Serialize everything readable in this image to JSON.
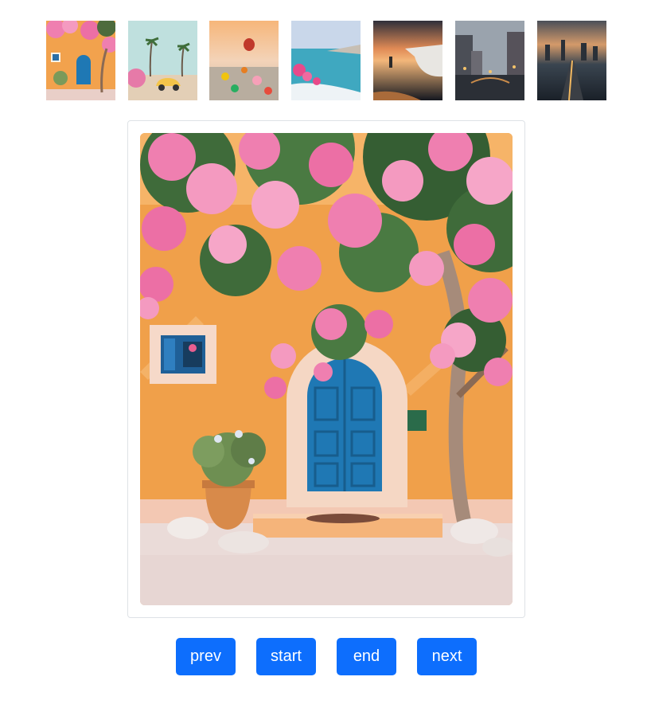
{
  "gallery": {
    "thumbnails": [
      {
        "name": "thumb-orange-house"
      },
      {
        "name": "thumb-palm-yellow-car"
      },
      {
        "name": "thumb-hot-air-balloons"
      },
      {
        "name": "thumb-santorini-bay"
      },
      {
        "name": "thumb-sunset-coast"
      },
      {
        "name": "thumb-canal-city"
      },
      {
        "name": "thumb-city-skyline"
      }
    ],
    "selected_index": 0
  },
  "controls": {
    "prev_label": "prev",
    "start_label": "start",
    "end_label": "end",
    "next_label": "next"
  },
  "colors": {
    "button_bg": "#0d6efd",
    "button_text": "#ffffff",
    "frame_border": "#dee2e6",
    "wall": "#f0a04a",
    "door": "#1f78b4",
    "flower": "#ef7fb0"
  }
}
